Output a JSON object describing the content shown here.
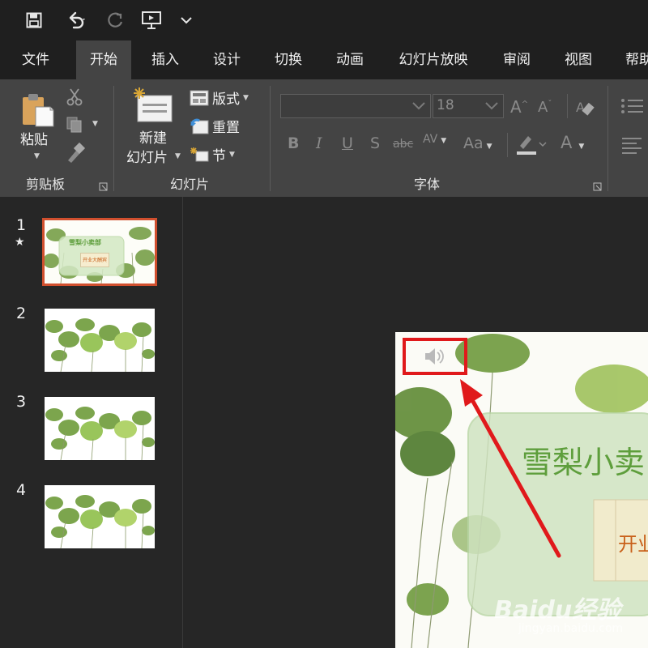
{
  "qat": {
    "icons": [
      "save-icon",
      "undo-icon",
      "redo-icon",
      "present-from-start-icon",
      "customize-qat-icon"
    ]
  },
  "tabs": [
    {
      "label": "文件"
    },
    {
      "label": "开始",
      "active": true
    },
    {
      "label": "插入"
    },
    {
      "label": "设计"
    },
    {
      "label": "切换"
    },
    {
      "label": "动画"
    },
    {
      "label": "幻灯片放映"
    },
    {
      "label": "审阅"
    },
    {
      "label": "视图"
    },
    {
      "label": "帮助"
    }
  ],
  "ribbon": {
    "clipboard": {
      "paste_label": "粘贴",
      "group_label": "剪贴板"
    },
    "slides": {
      "new_slide_line1": "新建",
      "new_slide_line2": "幻灯片",
      "layout_label": "版式",
      "reset_label": "重置",
      "section_label": "节",
      "group_label": "幻灯片"
    },
    "font": {
      "font_name": "",
      "font_size": "18",
      "group_label": "字体",
      "buttons": [
        "B",
        "I",
        "U",
        "S",
        "abc",
        "AV",
        "Aa",
        "A"
      ]
    }
  },
  "slides_panel": {
    "slides": [
      {
        "number": "1",
        "has_animation": true,
        "thumb_title": "雪梨小卖部",
        "thumb_subtitle": "开业大酬宾"
      },
      {
        "number": "2"
      },
      {
        "number": "3"
      },
      {
        "number": "4"
      }
    ],
    "animation_mark": "★"
  },
  "slide": {
    "title": "雪梨小卖",
    "subtitle": "开业",
    "audio_icon": "speaker-icon"
  },
  "watermark": {
    "brand": "Baidu经验",
    "url": "jingyan.baidu.com"
  },
  "colors": {
    "selection": "#d04f2e",
    "annotation": "#e0191b",
    "title_green": "#5e9e3c",
    "subtitle_orange": "#c8601a"
  }
}
